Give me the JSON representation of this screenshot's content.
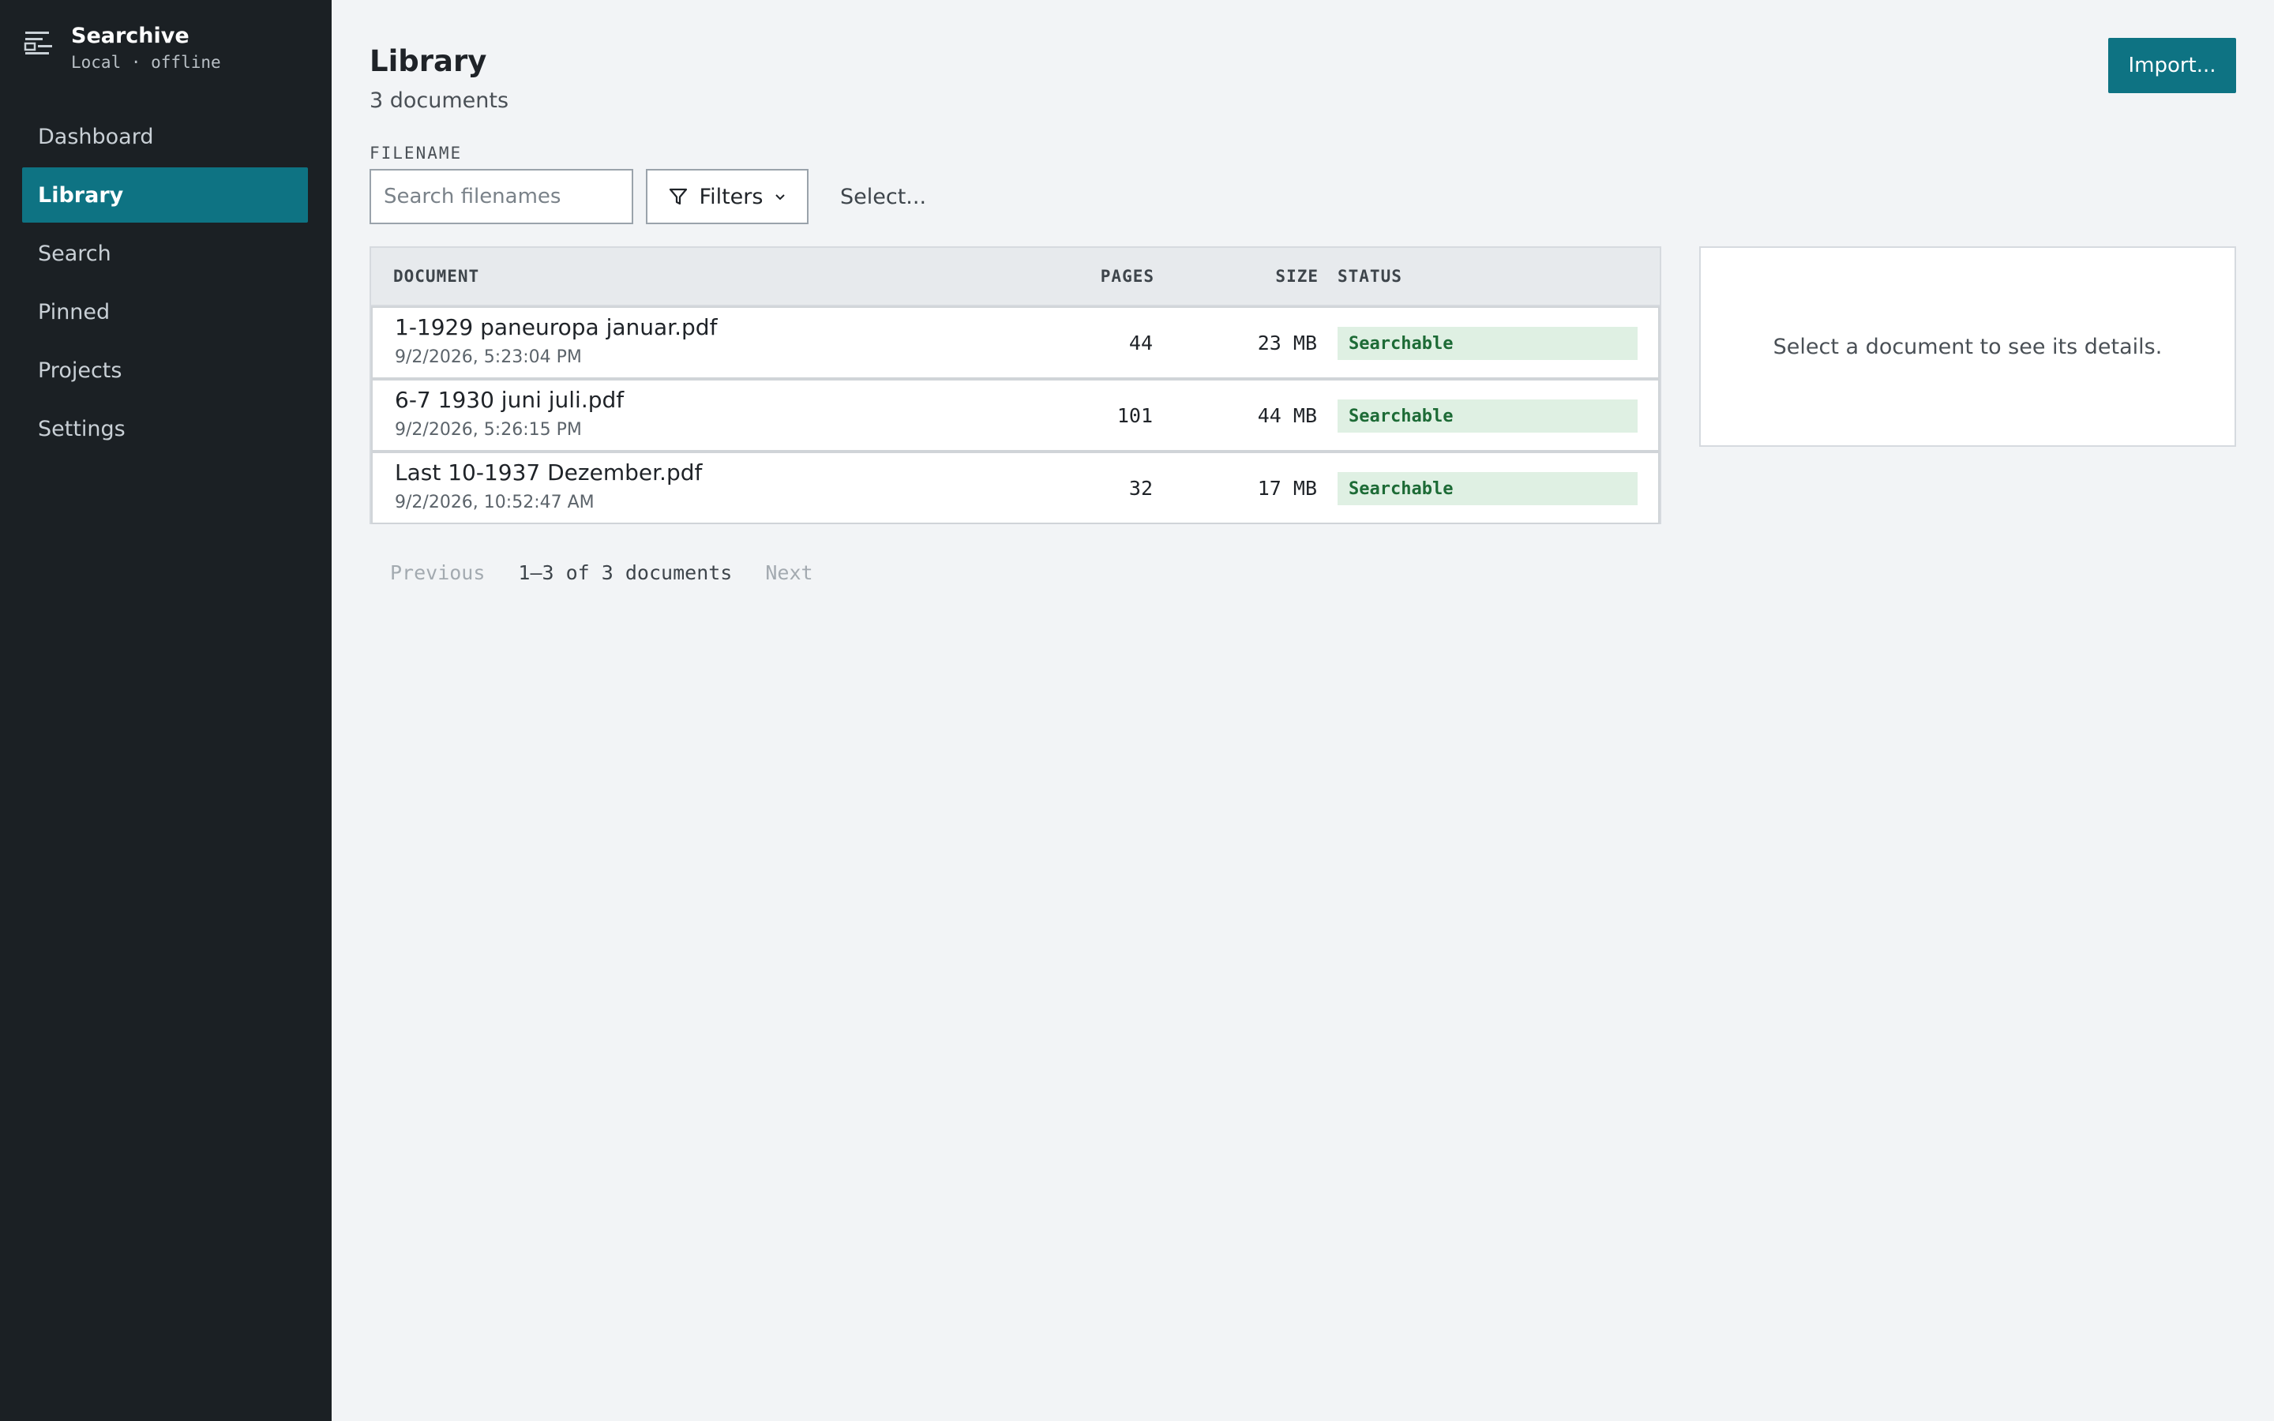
{
  "brand": {
    "name": "Searchive",
    "subtitle": "Local · offline",
    "icon": "list-archive-icon"
  },
  "sidebar": {
    "items": [
      {
        "label": "Dashboard",
        "active": false
      },
      {
        "label": "Library",
        "active": true
      },
      {
        "label": "Search",
        "active": false
      },
      {
        "label": "Pinned",
        "active": false
      },
      {
        "label": "Projects",
        "active": false
      },
      {
        "label": "Settings",
        "active": false
      }
    ]
  },
  "header": {
    "title": "Library",
    "count": "3 documents",
    "import_label": "Import..."
  },
  "filters": {
    "field_label": "FILENAME",
    "search_placeholder": "Search filenames",
    "search_value": "",
    "filters_label": "Filters",
    "select_label": "Select..."
  },
  "table": {
    "columns": {
      "document": "DOCUMENT",
      "pages": "PAGES",
      "size": "SIZE",
      "status": "STATUS"
    },
    "rows": [
      {
        "name": "1-1929 paneuropa januar.pdf",
        "date": "9/2/2026, 5:23:04 PM",
        "pages": "44",
        "size": "23 MB",
        "status": "Searchable"
      },
      {
        "name": "6-7 1930 juni juli.pdf",
        "date": "9/2/2026, 5:26:15 PM",
        "pages": "101",
        "size": "44 MB",
        "status": "Searchable"
      },
      {
        "name": "Last 10-1937 Dezember.pdf",
        "date": "9/2/2026, 10:52:47 AM",
        "pages": "32",
        "size": "17 MB",
        "status": "Searchable"
      }
    ]
  },
  "detail": {
    "empty_text": "Select a document to see its details."
  },
  "pagination": {
    "previous": "Previous",
    "info": "1–3 of 3 documents",
    "next": "Next"
  },
  "colors": {
    "accent": "#0e7383",
    "sidebar_bg": "#1b2024",
    "badge_bg": "#dff0e3",
    "badge_text": "#1d6b36"
  }
}
